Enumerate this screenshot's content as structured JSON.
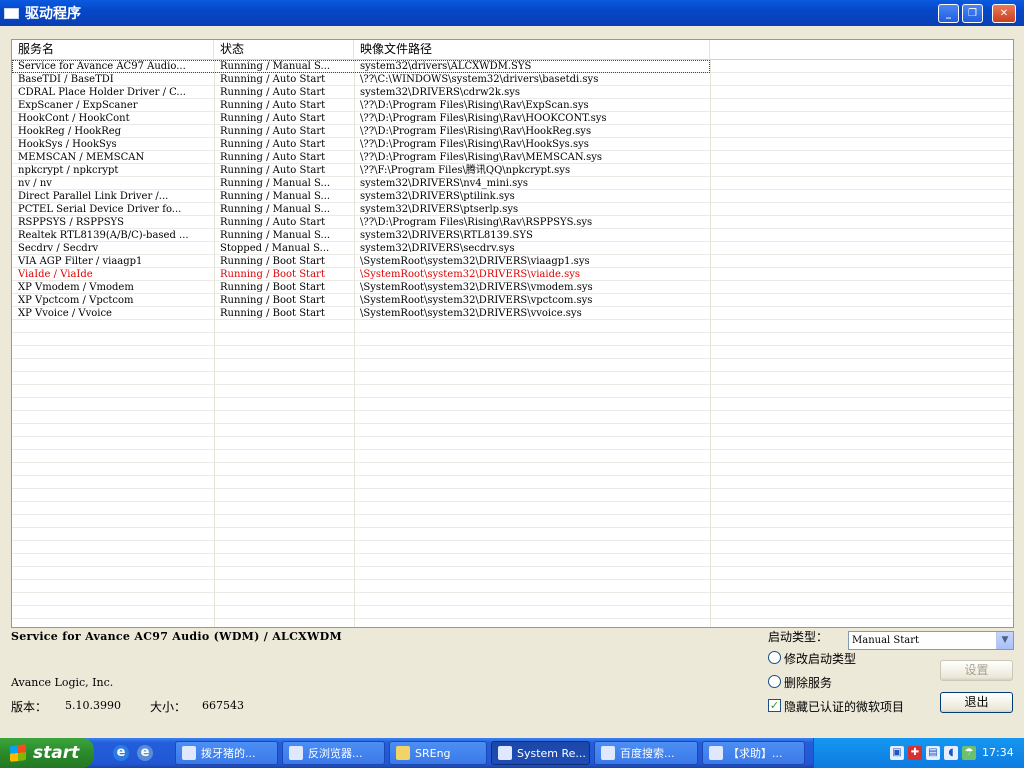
{
  "window": {
    "title": "驱动程序"
  },
  "list": {
    "columns": [
      "服务名",
      "状态",
      "映像文件路径",
      ""
    ],
    "rows": [
      {
        "name": "Service for Avance AC97 Audio...",
        "status": "Running / Manual S...",
        "path": "system32\\drivers\\ALCXWDM.SYS",
        "red": false
      },
      {
        "name": "BaseTDI / BaseTDI",
        "status": "Running / Auto Start",
        "path": "\\??\\C:\\WINDOWS\\system32\\drivers\\basetdi.sys",
        "red": false
      },
      {
        "name": "CDRAL Place Holder Driver / C...",
        "status": "Running / Auto Start",
        "path": "system32\\DRIVERS\\cdrw2k.sys",
        "red": false
      },
      {
        "name": "ExpScaner / ExpScaner",
        "status": "Running / Auto Start",
        "path": "\\??\\D:\\Program Files\\Rising\\Rav\\ExpScan.sys",
        "red": false
      },
      {
        "name": "HookCont / HookCont",
        "status": "Running / Auto Start",
        "path": "\\??\\D:\\Program Files\\Rising\\Rav\\HOOKCONT.sys",
        "red": false
      },
      {
        "name": "HookReg / HookReg",
        "status": "Running / Auto Start",
        "path": "\\??\\D:\\Program Files\\Rising\\Rav\\HookReg.sys",
        "red": false
      },
      {
        "name": "HookSys / HookSys",
        "status": "Running / Auto Start",
        "path": "\\??\\D:\\Program Files\\Rising\\Rav\\HookSys.sys",
        "red": false
      },
      {
        "name": "MEMSCAN / MEMSCAN",
        "status": "Running / Auto Start",
        "path": "\\??\\D:\\Program Files\\Rising\\Rav\\MEMSCAN.sys",
        "red": false
      },
      {
        "name": "npkcrypt / npkcrypt",
        "status": "Running / Auto Start",
        "path": "\\??\\F:\\Program Files\\腾讯QQ\\npkcrypt.sys",
        "red": false
      },
      {
        "name": "nv / nv",
        "status": "Running / Manual S...",
        "path": "system32\\DRIVERS\\nv4_mini.sys",
        "red": false
      },
      {
        "name": "Direct Parallel Link Driver /...",
        "status": "Running / Manual S...",
        "path": "system32\\DRIVERS\\ptilink.sys",
        "red": false
      },
      {
        "name": "PCTEL Serial Device Driver fo...",
        "status": "Running / Manual S...",
        "path": "system32\\DRIVERS\\ptserlp.sys",
        "red": false
      },
      {
        "name": "RSPPSYS / RSPPSYS",
        "status": "Running / Auto Start",
        "path": "\\??\\D:\\Program Files\\Rising\\Rav\\RSPPSYS.sys",
        "red": false
      },
      {
        "name": "Realtek RTL8139(A/B/C)-based ...",
        "status": "Running / Manual S...",
        "path": "system32\\DRIVERS\\RTL8139.SYS",
        "red": false
      },
      {
        "name": "Secdrv / Secdrv",
        "status": "Stopped / Manual S...",
        "path": "system32\\DRIVERS\\secdrv.sys",
        "red": false
      },
      {
        "name": "VIA AGP Filter / viaagp1",
        "status": "Running / Boot Start",
        "path": "\\SystemRoot\\system32\\DRIVERS\\viaagp1.sys",
        "red": false
      },
      {
        "name": "ViaIde / ViaIde",
        "status": "Running / Boot Start",
        "path": "\\SystemRoot\\system32\\DRIVERS\\viaide.sys",
        "red": true
      },
      {
        "name": "XP Vmodem / Vmodem",
        "status": "Running / Boot Start",
        "path": "\\SystemRoot\\system32\\DRIVERS\\vmodem.sys",
        "red": false
      },
      {
        "name": "XP Vpctcom / Vpctcom",
        "status": "Running / Boot Start",
        "path": "\\SystemRoot\\system32\\DRIVERS\\vpctcom.sys",
        "red": false
      },
      {
        "name": "XP Vvoice / Vvoice",
        "status": "Running / Boot Start",
        "path": "\\SystemRoot\\system32\\DRIVERS\\vvoice.sys",
        "red": false
      }
    ]
  },
  "detail": {
    "service_name": "Service for Avance AC97 Audio (WDM) / ALCXWDM",
    "company": "Avance Logic, Inc.",
    "version_label": "版本：",
    "version_value": "5.10.3990",
    "size_label": "大小：",
    "size_value": "667543"
  },
  "controls": {
    "startup_type_label": "启动类型：",
    "startup_type_value": "Manual Start",
    "modify_startup_label": "修改启动类型",
    "delete_service_label": "删除服务",
    "hide_ms_label": "隐藏已认证的微软项目",
    "hide_ms_checked": true,
    "settings_button": "设置",
    "exit_button": "退出"
  },
  "taskbar": {
    "start_label": "start",
    "tasks": [
      "拨牙猪的...",
      "反浏览器...",
      "SREng",
      "System Re...",
      "百度搜索...",
      "【求助】..."
    ],
    "active_task": "System Re...",
    "clock": "17:34"
  }
}
